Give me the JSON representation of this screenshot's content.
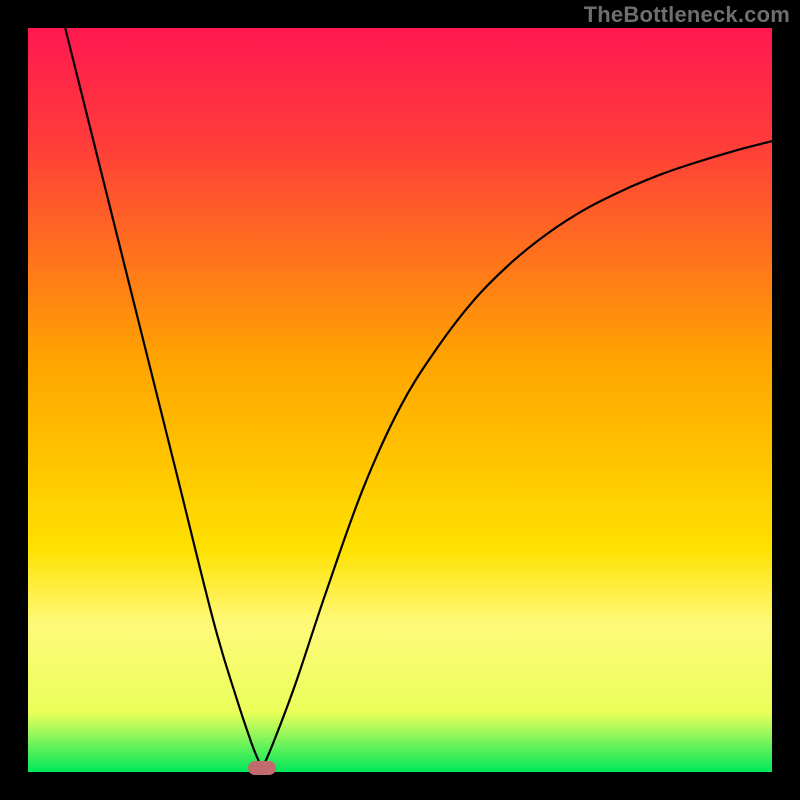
{
  "watermark": "TheBottleneck.com",
  "chart_data": {
    "type": "line",
    "title": "",
    "xlabel": "",
    "ylabel": "",
    "xlim": [
      0,
      100
    ],
    "ylim": [
      0,
      100
    ],
    "grid": false,
    "legend": false,
    "gradient_stops": [
      {
        "offset": 0,
        "color": "#ff1850"
      },
      {
        "offset": 15,
        "color": "#ff3b3b"
      },
      {
        "offset": 45,
        "color": "#ffa500"
      },
      {
        "offset": 70,
        "color": "#ffe100"
      },
      {
        "offset": 80,
        "color": "#fff97a"
      },
      {
        "offset": 92,
        "color": "#eaff5a"
      },
      {
        "offset": 100,
        "color": "#00e85a"
      }
    ],
    "series": [
      {
        "name": "left-branch",
        "x": [
          5,
          10,
          15,
          20,
          25,
          28,
          30,
          31,
          31.5
        ],
        "values": [
          100,
          80,
          60,
          40,
          20,
          10,
          4,
          1.5,
          0.5
        ]
      },
      {
        "name": "right-branch",
        "x": [
          31.5,
          33,
          36,
          40,
          45,
          50,
          55,
          60,
          65,
          70,
          75,
          80,
          85,
          90,
          95,
          100
        ],
        "values": [
          0.5,
          4,
          12,
          24,
          38,
          49,
          57,
          63.5,
          68.5,
          72.5,
          75.7,
          78.2,
          80.3,
          82.0,
          83.5,
          84.8
        ]
      }
    ],
    "annotations": [
      {
        "name": "min-marker",
        "x": 31.5,
        "y": 0.5,
        "shape": "pill",
        "color": "#c36a6e"
      }
    ]
  }
}
